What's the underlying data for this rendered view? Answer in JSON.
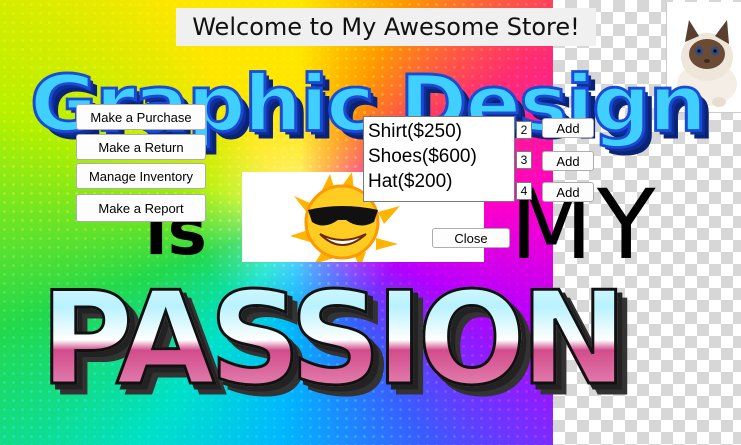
{
  "window": {
    "title": "Welcome to My Awesome Store!"
  },
  "banner": {
    "line1": "Graphic Design",
    "line2_left": "is",
    "line2_right": "MY",
    "line3": "PASSION"
  },
  "menu": {
    "buttons": [
      "Make a Purchase",
      "Make a Return",
      "Manage Inventory",
      "Make a Report"
    ]
  },
  "products": {
    "items": [
      "Shirt($250)",
      "Shoes($600)",
      "Hat($200)"
    ],
    "quantities": [
      "2",
      "3",
      "4"
    ],
    "add_label": "Add"
  },
  "dialog": {
    "close_label": "Close"
  },
  "images": {
    "cat": "siamese-kitten-photo",
    "sun": "sun-with-sunglasses-clipart"
  }
}
